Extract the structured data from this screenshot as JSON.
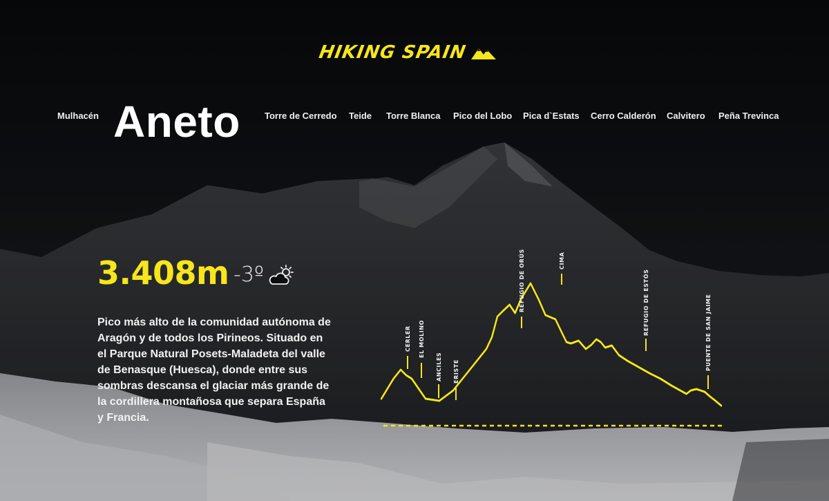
{
  "brand": {
    "name": "HIKING SPAIN",
    "accent_color": "#f6e61a"
  },
  "nav": {
    "left_item": "Mulhacén",
    "active_item": "Aneto",
    "right_items": [
      "Torre de Cerredo",
      "Teide",
      "Torre Blanca",
      "Pico del Lobo",
      "Pica d`Estats",
      "Cerro Calderón",
      "Calvitero",
      "Peña Trevinca"
    ]
  },
  "peak": {
    "elevation": "3.408m",
    "temperature": "-3º",
    "weather_icon": "partly-cloudy-icon",
    "description": "Pico más alto de la comunidad autónoma de Aragón y de todos los Pirineos. Situado en el Parque Natural Posets-Maladeta del valle de Benasque (Huesca), donde entre sus sombras descansa el glaciar más grande de la cordillera montañosa que separa España y Francia."
  },
  "route_profile": {
    "waypoints": [
      "CERLER",
      "EL MOLINO",
      "ANCILES",
      "ERISTE",
      "REFUGIO DE ORÚS",
      "CIMA",
      "REFUGIO DE ESTÓS",
      "PUENTE DE SAN JAIME"
    ]
  }
}
